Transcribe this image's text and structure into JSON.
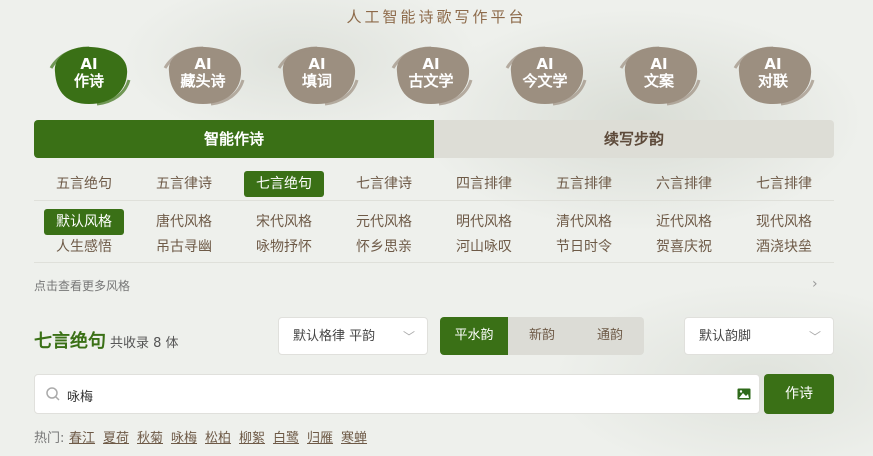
{
  "site_title": "人工智能诗歌写作平台",
  "nav": [
    {
      "line1": "AI",
      "line2": "作诗",
      "active": true
    },
    {
      "line1": "AI",
      "line2": "藏头诗",
      "active": false
    },
    {
      "line1": "AI",
      "line2": "填词",
      "active": false
    },
    {
      "line1": "AI",
      "line2": "古文学",
      "active": false
    },
    {
      "line1": "AI",
      "line2": "今文学",
      "active": false
    },
    {
      "line1": "AI",
      "line2": "文案",
      "active": false
    },
    {
      "line1": "AI",
      "line2": "对联",
      "active": false
    }
  ],
  "main_tabs": {
    "active": "智能作诗",
    "inactive": "续写步韵"
  },
  "forms": [
    "五言绝句",
    "五言律诗",
    "七言绝句",
    "七言律诗",
    "四言排律",
    "五言排律",
    "六言排律",
    "七言排律"
  ],
  "forms_selected": 2,
  "styles_row1": [
    "默认风格",
    "唐代风格",
    "宋代风格",
    "元代风格",
    "明代风格",
    "清代风格",
    "近代风格",
    "现代风格"
  ],
  "styles_row2": [
    "人生感悟",
    "吊古寻幽",
    "咏物抒怀",
    "怀乡思亲",
    "河山咏叹",
    "节日时令",
    "贺喜庆祝",
    "酒浇块垒"
  ],
  "styles_selected": 0,
  "more_styles": "点击查看更多风格",
  "form_info": {
    "title": "七言绝句",
    "count": "共收录 8 体"
  },
  "meter_dropdown": "默认格律 平韵",
  "rhyme_buttons": [
    "平水韵",
    "新韵",
    "通韵"
  ],
  "rhyme_selected": 0,
  "rhyme_foot_dropdown": "默认韵脚",
  "search": {
    "value": "咏梅"
  },
  "submit_label": "作诗",
  "hot": {
    "label": "热门:",
    "tags": [
      "春江",
      "夏荷",
      "秋菊",
      "咏梅",
      "松柏",
      "柳絮",
      "白鹭",
      "归雁",
      "寒蝉"
    ]
  },
  "colors": {
    "primary_green": "#3a7016",
    "brush_brown": "#9c8f80",
    "text_brown": "#6e5a47"
  }
}
